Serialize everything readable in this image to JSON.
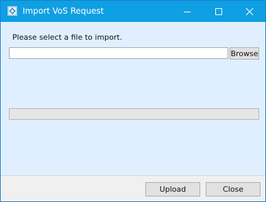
{
  "window": {
    "title": "Import VoS Request",
    "icon": "app-diamond-icon",
    "controls": [
      "minimize-icon",
      "maximize-icon",
      "close-icon"
    ]
  },
  "main": {
    "prompt": "Please select a file to import.",
    "file_path": {
      "value": "",
      "placeholder": ""
    },
    "browse_label": "Browse",
    "progress": 0
  },
  "footer": {
    "upload_label": "Upload",
    "close_label": "Close"
  },
  "colors": {
    "titlebar": "#0f9fe3",
    "body": "#e0efff",
    "footer": "#f0f0f0"
  }
}
